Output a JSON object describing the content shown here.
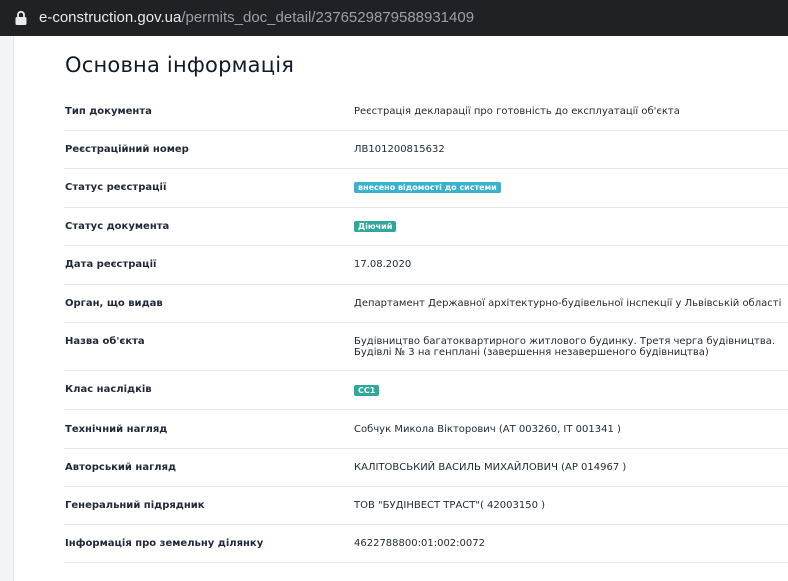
{
  "browser": {
    "url_host": "e-construction.gov.ua",
    "url_path": "/permits_doc_detail/2376529879588931409",
    "lock_icon": "lock-icon"
  },
  "page": {
    "title": "Основна інформація"
  },
  "colors": {
    "registration_status_badge": "#38b2cf",
    "document_status_badge": "#2ea89a",
    "consequence_class_badge": "#2ea89a"
  },
  "rows": [
    {
      "label": "Тип документа",
      "value": "Реєстрація декларації про готовність до експлуатації об'єкта"
    },
    {
      "label": "Реєстраційний номер",
      "value": "ЛВ101200815632"
    },
    {
      "label": "Статус реєстрації",
      "value": "внесено відомості до системи"
    },
    {
      "label": "Статус документа",
      "value": "Діючий"
    },
    {
      "label": "Дата реєстрації",
      "value": "17.08.2020"
    },
    {
      "label": "Орган, що видав",
      "value": "Департамент Державної архітектурно-будівельної інспекції у Львівській області"
    },
    {
      "label": "Назва об'єкта",
      "value": "Будівництво багатоквартирного житлового будинку. Третя черга будівництва. Будівлі № 3 на генплані (завершення незавершеного будівництва)"
    },
    {
      "label": "Клас наслідків",
      "value": "СС1"
    },
    {
      "label": "Технічний нагляд",
      "value": "Собчук Микола Вікторович (АТ 003260, ІТ 001341 )"
    },
    {
      "label": "Авторський нагляд",
      "value": "КАЛІТОВСЬКИЙ ВАСИЛЬ МИХАЙЛОВИЧ (АР 014967 )"
    },
    {
      "label": "Генеральний підрядник",
      "value": "ТОВ \"БУДІНВЕСТ ТРАСТ\"( 42003150 )"
    },
    {
      "label": "Інформація про земельну ділянку",
      "value": "4622788800:01:002:0072"
    }
  ]
}
